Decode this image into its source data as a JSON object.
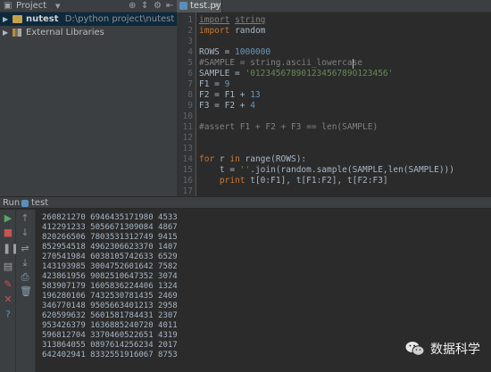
{
  "project_panel": {
    "title": "Project",
    "tree": [
      {
        "name": "nutest",
        "path": "D:\\python project\\nutest",
        "selected": true
      },
      {
        "name": "External Libraries",
        "path": "",
        "selected": false
      }
    ]
  },
  "editor": {
    "tab_label": "test.py",
    "line_numbers": [
      "1",
      "2",
      "3",
      "4",
      "5",
      "6",
      "7",
      "8",
      "9",
      "10",
      "11",
      "12",
      "13",
      "14",
      "15",
      "16",
      "17"
    ],
    "lines": [
      "import string",
      "import random",
      "",
      "ROWS = 1000000",
      "#SAMPLE = string.ascii_lowercase",
      "SAMPLE = '01234567890123456789O123456'",
      "F1 = 9",
      "F2 = F1 + 13",
      "F3 = F2 + 4",
      "",
      "#assert F1 + F2 + F3 == len(SAMPLE)",
      "",
      "",
      "for r in range(ROWS):",
      "    t = ''.join(random.sample(SAMPLE,len(SAMPLE)))",
      "    print t[0:F1], t[F1:F2], t[F2:F3]",
      ""
    ],
    "l1": {
      "kw": "import",
      "mod": "string"
    },
    "l2": {
      "kw": "import",
      "mod": "random"
    },
    "l4": {
      "name": "ROWS = ",
      "num": "1000000"
    },
    "l5": {
      "cmt": "#SAMPLE = string.ascii_lowercase"
    },
    "l6": {
      "name": "SAMPLE = ",
      "str": "'01234567890123456789O123456'"
    },
    "l7": {
      "name": "F1 = ",
      "num": "9"
    },
    "l8": {
      "name": "F2 = F1 + ",
      "num": "13"
    },
    "l9": {
      "name": "F3 = F2 + ",
      "num": "4"
    },
    "l11": {
      "cmt": "#assert F1 + F2 + F3 == len(SAMPLE)"
    },
    "l14": {
      "kw1": "for",
      "mid1": " r ",
      "kw2": "in",
      "mid2": " range(ROWS):"
    },
    "l15": {
      "pre": "    t = ",
      "str": "''",
      "post": ".join(random.sample(SAMPLE,len(SAMPLE)))"
    },
    "l16": {
      "pre": "    ",
      "kw": "print",
      "post": " t[0:F1], t[F1:F2], t[F2:F3]"
    }
  },
  "run_panel": {
    "label": "Run",
    "config": "test",
    "output": [
      "260821270 6946435171980 4533",
      "412291233 5056671309084 4867",
      "820266506 7803531312749 9415",
      "852954518 4962306623370 1407",
      "270541984 6038105742633 6529",
      "143193985 3004752601642 7582",
      "423861956 9082510647352 3074",
      "583907179 1605836224406 1324",
      "196280106 7432530781435 2469",
      "346770148 9505663401213 2958",
      "620599632 5601581784431 2307",
      "953426379 1636885240720 4011",
      "596812704 3370460522651 4319",
      "313864055 0897614256234 2017",
      "642402941 8332551916067 8753"
    ]
  },
  "watermark": {
    "text": "数据科学"
  },
  "colors": {
    "accent": "#0d293e",
    "keyword": "#cc7832",
    "number": "#6897bb",
    "string": "#6a8759",
    "comment": "#808080"
  }
}
